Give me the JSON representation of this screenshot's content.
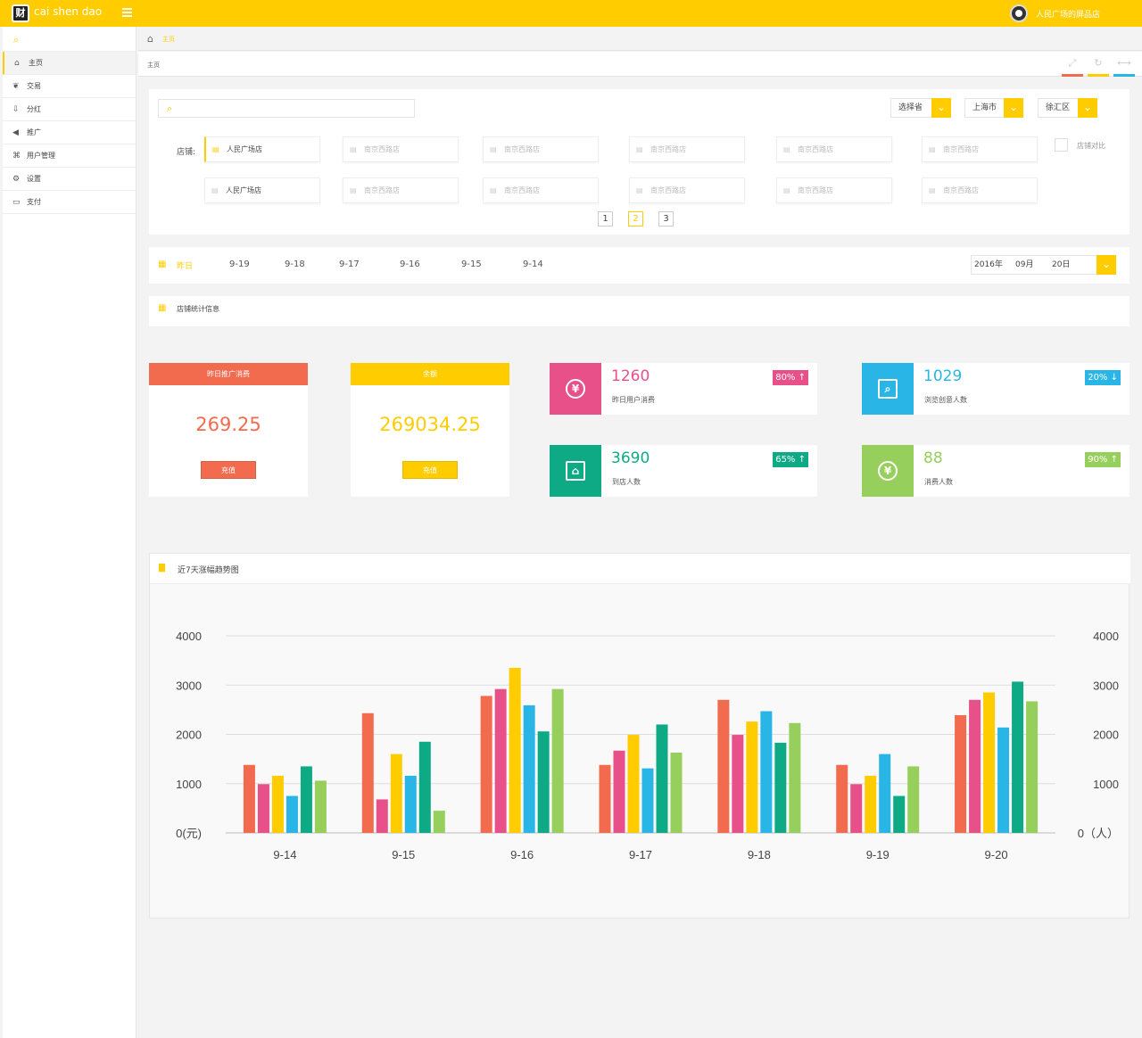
{
  "header": {
    "brand": "cai shen  dao",
    "logo_text": "财",
    "store_name": "人民广场的屏品店"
  },
  "sidebar": {
    "items": [
      {
        "label": "主页",
        "icon": "home-icon"
      },
      {
        "label": "交易",
        "icon": "handshake-icon"
      },
      {
        "label": "分红",
        "icon": "download-icon"
      },
      {
        "label": "推广",
        "icon": "megaphone-icon"
      },
      {
        "label": "用户管理",
        "icon": "users-icon"
      },
      {
        "label": "设置",
        "icon": "gear-icon"
      },
      {
        "label": "支付",
        "icon": "card-icon"
      }
    ]
  },
  "breadcrumb": {
    "label": "主页"
  },
  "tab": {
    "label": "主页"
  },
  "tab_tools": {
    "colors": [
      "#f26b4f",
      "#ffcc00",
      "#29b6e6"
    ]
  },
  "filters": {
    "province": "选择省",
    "city": "上海市",
    "district": "徐汇区",
    "shop_label": "店铺:",
    "compare_label": "店铺对比",
    "shops_row1": [
      "人民广场店",
      "南京西路店",
      "南京西路店",
      "南京西路店",
      "南京西路店",
      "南京西路店"
    ],
    "shops_row2": [
      "人民广场店",
      "南京西路店",
      "南京西路店",
      "南京西路店",
      "南京西路店",
      "南京西路店"
    ],
    "pages": [
      "1",
      "2",
      "3"
    ],
    "active_page": "2"
  },
  "dates": {
    "tabs": [
      "昨日",
      "9-19",
      "9-18",
      "9-17",
      "9-16",
      "9-15",
      "9-14"
    ],
    "year": "2016年",
    "month": "09月",
    "day": "20日"
  },
  "stats": {
    "title": "店铺统计信息",
    "ad_spend": {
      "title": "昨日推广消费",
      "value": "269.25",
      "button": "充值",
      "color": "#f26b4f"
    },
    "balance": {
      "title": "余额",
      "value": "269034.25",
      "button": "充值",
      "color": "#ffcc00"
    },
    "metrics": [
      {
        "value": "1260",
        "label": "昨日用户消费",
        "badge": "80%",
        "trend": "up",
        "color": "#e8508a",
        "icon": "yuan-icon"
      },
      {
        "value": "1029",
        "label": "浏览创意人数",
        "badge": "20%",
        "trend": "down",
        "color": "#29b6e6",
        "icon": "browse-search-icon"
      },
      {
        "value": "3690",
        "label": "到店人数",
        "badge": "65%",
        "trend": "up",
        "color": "#0eaa86",
        "icon": "store-icon"
      },
      {
        "value": "88",
        "label": "消费人数",
        "badge": "90%",
        "trend": "up",
        "color": "#97cf5c",
        "icon": "users-money-icon"
      }
    ]
  },
  "chart_title": "近7天涨幅趋势图",
  "chart_data": {
    "type": "bar",
    "categories": [
      "9-14",
      "9-15",
      "9-16",
      "9-17",
      "9-18",
      "9-19",
      "9-20"
    ],
    "series": [
      {
        "color": "#f26b4f",
        "values": [
          1380,
          2430,
          2780,
          1380,
          2700,
          1380,
          2390
        ]
      },
      {
        "color": "#e8508a",
        "values": [
          990,
          680,
          2920,
          1670,
          1990,
          990,
          2700
        ]
      },
      {
        "color": "#ffcc00",
        "values": [
          1160,
          1600,
          3350,
          1990,
          2260,
          1160,
          2850
        ]
      },
      {
        "color": "#29b6e6",
        "values": [
          750,
          1160,
          2590,
          1310,
          2470,
          1600,
          2140
        ]
      },
      {
        "color": "#0eaa86",
        "values": [
          1350,
          1850,
          2060,
          2200,
          1830,
          750,
          3070
        ]
      },
      {
        "color": "#97cf5c",
        "values": [
          1060,
          450,
          2920,
          1630,
          2230,
          1350,
          2670
        ]
      }
    ],
    "y_left": {
      "ticks": [
        "0(元)",
        "1000",
        "2000",
        "3000",
        "4000"
      ],
      "range": [
        0,
        4000
      ]
    },
    "y_right": {
      "ticks": [
        "0（人）",
        "1000",
        "2000",
        "3000",
        "4000"
      ],
      "range": [
        0,
        4000
      ]
    },
    "grid": true
  }
}
